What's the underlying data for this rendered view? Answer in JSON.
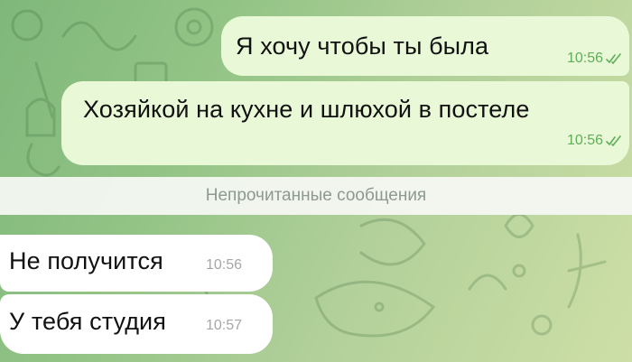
{
  "chat": {
    "unread_divider": "Непрочитанные сообщения",
    "messages": [
      {
        "direction": "outgoing",
        "text": "Я хочу чтобы ты была",
        "time": "10:56",
        "status": "read"
      },
      {
        "direction": "outgoing",
        "text": "Хозяйкой на кухне и шлюхой в постеле",
        "time": "10:56",
        "status": "read"
      },
      {
        "direction": "incoming",
        "text": "Не получится",
        "time": "10:56"
      },
      {
        "direction": "incoming",
        "text": "У тебя студия",
        "time": "10:57"
      }
    ]
  },
  "colors": {
    "outgoing_bubble": "#e9f8d6",
    "incoming_bubble": "#ffffff",
    "read_checks": "#5fae5a",
    "wallpaper": "#93c486"
  },
  "icons": {
    "read_status": "double-check-icon"
  }
}
